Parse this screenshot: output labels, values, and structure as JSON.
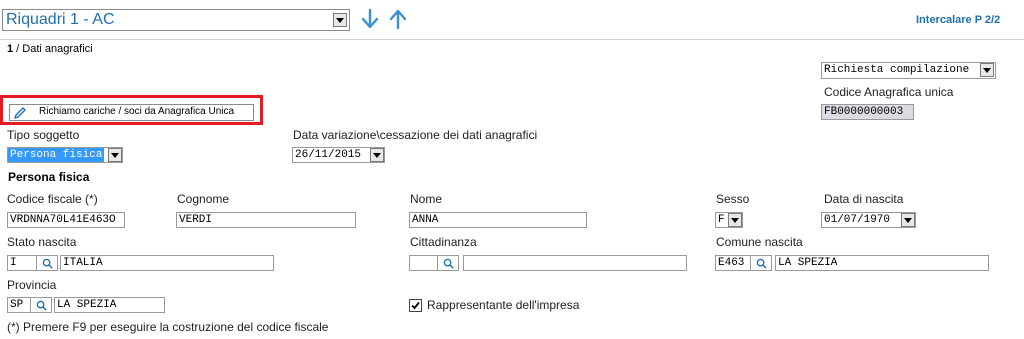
{
  "header": {
    "panel_select": "Riquadri 1 - AC",
    "intercalare": "Intercalare P 2/2"
  },
  "section": {
    "title_num": "1",
    "title_text": " / Dati anagrafici"
  },
  "richiesta": {
    "value": "Richiesta compilazione",
    "codice_label": "Codice Anagrafica unica",
    "codice_value": "FB0000000003"
  },
  "richiamo_button": "Richiamo cariche / soci da Anagrafica Unica",
  "tipo_soggetto": {
    "label": "Tipo soggetto",
    "value": "Persona fisica"
  },
  "data_variazione": {
    "label": "Data variazione\\cessazione dei dati anagrafici",
    "value": "26/11/2015"
  },
  "persona_fisica_heading": "Persona fisica",
  "codice_fiscale": {
    "label": "Codice fiscale (*)",
    "value": "VRDNNA70L41E463O"
  },
  "cognome": {
    "label": "Cognome",
    "value": "VERDI"
  },
  "nome": {
    "label": "Nome",
    "value": "ANNA"
  },
  "sesso": {
    "label": "Sesso",
    "value": "F"
  },
  "data_nascita": {
    "label": "Data di nascita",
    "value": "01/07/1970"
  },
  "stato_nascita": {
    "label": "Stato nascita",
    "code": "I",
    "desc": "ITALIA"
  },
  "cittadinanza": {
    "label": "Cittadinanza",
    "code": "",
    "desc": ""
  },
  "comune_nascita": {
    "label": "Comune nascita",
    "code": "E463",
    "desc": "LA SPEZIA"
  },
  "provincia": {
    "label": "Provincia",
    "code": "SP",
    "desc": "LA SPEZIA"
  },
  "rappresentante": {
    "label": "Rappresentante dell'impresa",
    "checked": true
  },
  "footnote": "(*) Premere F9 per eseguire la costruzione del codice fiscale",
  "colors": {
    "accent": "#1f6fb2",
    "highlight_border": "#e31b23",
    "selection": "#3399ff"
  }
}
